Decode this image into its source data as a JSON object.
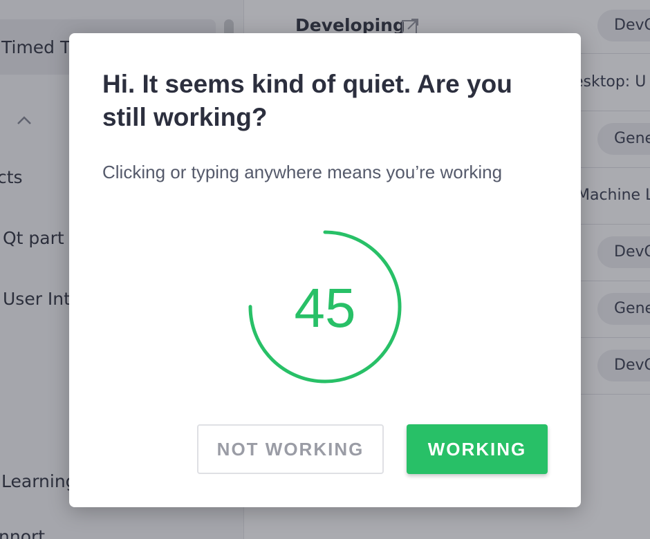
{
  "background": {
    "left_items": [
      {
        "label": "Timed T"
      },
      {
        "label": "cts"
      },
      {
        "label": "Qt part"
      },
      {
        "label": "User Int"
      },
      {
        "label": "Learning"
      },
      {
        "label": "nnort"
      }
    ],
    "header_link": "Developing",
    "tags": [
      "DevO",
      "esktop: U",
      "Gene",
      "Machine L",
      "DevO",
      "Gene",
      "DevO"
    ]
  },
  "dialog": {
    "title": "Hi. It seems kind of quiet. Are you still working?",
    "subtitle": "Clicking or typing anywhere means you’re working",
    "countdown": "45",
    "countdown_progress": 0.75,
    "buttons": {
      "not_working": "NOT WORKING",
      "working": "WORKING"
    }
  },
  "colors": {
    "accent": "#28c067",
    "overlay": "rgba(20,22,35,0.36)"
  },
  "icons": {
    "chevron": "chevron-up-icon",
    "external": "external-link-icon"
  }
}
